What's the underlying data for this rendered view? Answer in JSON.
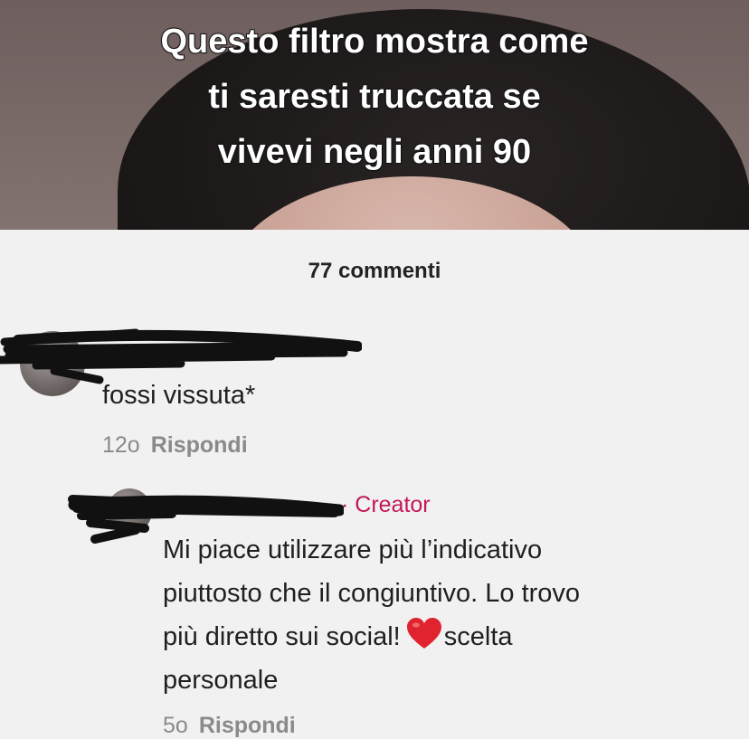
{
  "video": {
    "caption_lines": [
      "Questo filtro mostra come",
      "ti saresti truccata se",
      "vivevi negli anni 90"
    ]
  },
  "comments_header": {
    "count_label": "77 commenti"
  },
  "comments": [
    {
      "text": "fossi vissuta*",
      "time": "12o",
      "reply_label": "Rispondi"
    },
    {
      "badge": "· Creator",
      "text_lines": [
        "Mi piace utilizzare più l’indicativo",
        "piuttosto che il congiuntivo. Lo trovo",
        "più diretto sui social!",
        "scelta",
        "personale"
      ],
      "time": "5o",
      "reply_label": "Rispondi"
    }
  ],
  "icons": {
    "heart": "red-heart-emoji"
  },
  "colors": {
    "creator_badge": "#c2185b",
    "heart": "#e0242f",
    "sheet_bg": "#f2f1f2"
  }
}
